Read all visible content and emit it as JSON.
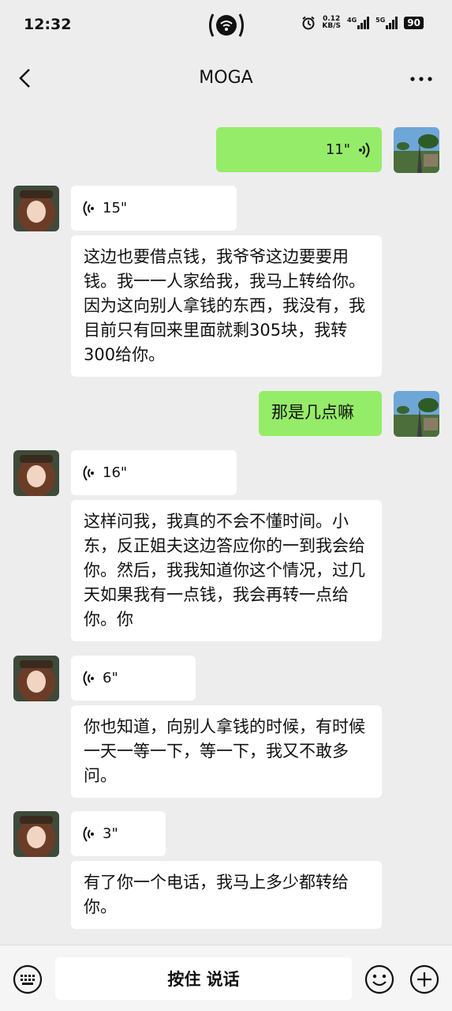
{
  "status_bar": {
    "time": "12:32",
    "net_speed_value": "0.12",
    "net_speed_unit": "KB/S",
    "signal1_label": "4G",
    "signal2_label": "5G",
    "battery": "90"
  },
  "nav": {
    "title": "MOGA",
    "back_icon": "chevron-left-icon",
    "more_icon": "ellipsis-icon"
  },
  "messages": [
    {
      "side": "out",
      "kind": "voice",
      "duration": "11\""
    },
    {
      "side": "in",
      "kind": "voice",
      "duration": "15\""
    },
    {
      "side": "in",
      "kind": "text",
      "text": "这边也要借点钱，我爷爷这边要要用钱。我一一人家给我，我马上转给你。因为这向别人拿钱的东西，我没有，我目前只有回来里面就剩305块，我转300给你。"
    },
    {
      "side": "out",
      "kind": "text",
      "text": "那是几点嘛"
    },
    {
      "side": "in",
      "kind": "voice",
      "duration": "16\""
    },
    {
      "side": "in",
      "kind": "text",
      "text": "这样问我，我真的不会不懂时间。小东，反正姐夫这边答应你的一到我会给你。然后，我我知道你这个情况，过几天如果我有一点钱，我会再转一点给你。你"
    },
    {
      "side": "in",
      "kind": "voice",
      "duration": "6\""
    },
    {
      "side": "in",
      "kind": "text",
      "text": "你也知道，向别人拿钱的时候，有时候一天一等一下，等一下，我又不敢多问。"
    },
    {
      "side": "in",
      "kind": "voice",
      "duration": "3\""
    },
    {
      "side": "in",
      "kind": "text",
      "text": "有了你一个电话，我马上多少都转给你。"
    }
  ],
  "input_bar": {
    "hold_to_talk": "按住 说话",
    "keyboard_icon": "keyboard-icon",
    "emoji_icon": "emoji-icon",
    "plus_icon": "plus-circle-icon"
  },
  "colors": {
    "background": "#ededed",
    "outgoing_bubble": "#95ec69",
    "incoming_bubble": "#ffffff"
  }
}
